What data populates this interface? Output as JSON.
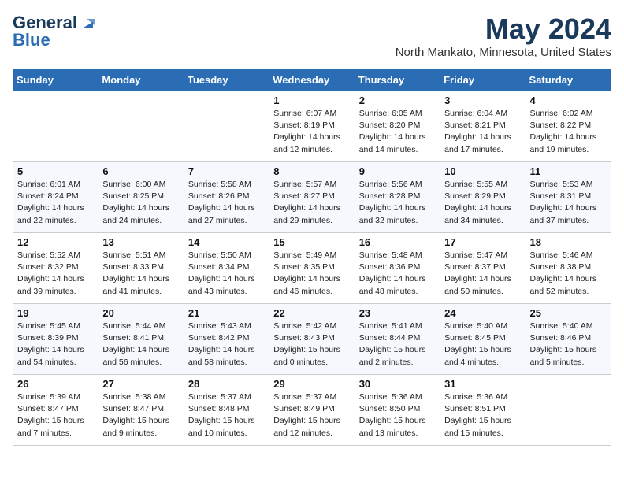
{
  "header": {
    "logo_general": "General",
    "logo_blue": "Blue",
    "month_title": "May 2024",
    "location": "North Mankato, Minnesota, United States"
  },
  "weekdays": [
    "Sunday",
    "Monday",
    "Tuesday",
    "Wednesday",
    "Thursday",
    "Friday",
    "Saturday"
  ],
  "weeks": [
    [
      {
        "day": "",
        "info": ""
      },
      {
        "day": "",
        "info": ""
      },
      {
        "day": "",
        "info": ""
      },
      {
        "day": "1",
        "info": "Sunrise: 6:07 AM\nSunset: 8:19 PM\nDaylight: 14 hours\nand 12 minutes."
      },
      {
        "day": "2",
        "info": "Sunrise: 6:05 AM\nSunset: 8:20 PM\nDaylight: 14 hours\nand 14 minutes."
      },
      {
        "day": "3",
        "info": "Sunrise: 6:04 AM\nSunset: 8:21 PM\nDaylight: 14 hours\nand 17 minutes."
      },
      {
        "day": "4",
        "info": "Sunrise: 6:02 AM\nSunset: 8:22 PM\nDaylight: 14 hours\nand 19 minutes."
      }
    ],
    [
      {
        "day": "5",
        "info": "Sunrise: 6:01 AM\nSunset: 8:24 PM\nDaylight: 14 hours\nand 22 minutes."
      },
      {
        "day": "6",
        "info": "Sunrise: 6:00 AM\nSunset: 8:25 PM\nDaylight: 14 hours\nand 24 minutes."
      },
      {
        "day": "7",
        "info": "Sunrise: 5:58 AM\nSunset: 8:26 PM\nDaylight: 14 hours\nand 27 minutes."
      },
      {
        "day": "8",
        "info": "Sunrise: 5:57 AM\nSunset: 8:27 PM\nDaylight: 14 hours\nand 29 minutes."
      },
      {
        "day": "9",
        "info": "Sunrise: 5:56 AM\nSunset: 8:28 PM\nDaylight: 14 hours\nand 32 minutes."
      },
      {
        "day": "10",
        "info": "Sunrise: 5:55 AM\nSunset: 8:29 PM\nDaylight: 14 hours\nand 34 minutes."
      },
      {
        "day": "11",
        "info": "Sunrise: 5:53 AM\nSunset: 8:31 PM\nDaylight: 14 hours\nand 37 minutes."
      }
    ],
    [
      {
        "day": "12",
        "info": "Sunrise: 5:52 AM\nSunset: 8:32 PM\nDaylight: 14 hours\nand 39 minutes."
      },
      {
        "day": "13",
        "info": "Sunrise: 5:51 AM\nSunset: 8:33 PM\nDaylight: 14 hours\nand 41 minutes."
      },
      {
        "day": "14",
        "info": "Sunrise: 5:50 AM\nSunset: 8:34 PM\nDaylight: 14 hours\nand 43 minutes."
      },
      {
        "day": "15",
        "info": "Sunrise: 5:49 AM\nSunset: 8:35 PM\nDaylight: 14 hours\nand 46 minutes."
      },
      {
        "day": "16",
        "info": "Sunrise: 5:48 AM\nSunset: 8:36 PM\nDaylight: 14 hours\nand 48 minutes."
      },
      {
        "day": "17",
        "info": "Sunrise: 5:47 AM\nSunset: 8:37 PM\nDaylight: 14 hours\nand 50 minutes."
      },
      {
        "day": "18",
        "info": "Sunrise: 5:46 AM\nSunset: 8:38 PM\nDaylight: 14 hours\nand 52 minutes."
      }
    ],
    [
      {
        "day": "19",
        "info": "Sunrise: 5:45 AM\nSunset: 8:39 PM\nDaylight: 14 hours\nand 54 minutes."
      },
      {
        "day": "20",
        "info": "Sunrise: 5:44 AM\nSunset: 8:41 PM\nDaylight: 14 hours\nand 56 minutes."
      },
      {
        "day": "21",
        "info": "Sunrise: 5:43 AM\nSunset: 8:42 PM\nDaylight: 14 hours\nand 58 minutes."
      },
      {
        "day": "22",
        "info": "Sunrise: 5:42 AM\nSunset: 8:43 PM\nDaylight: 15 hours\nand 0 minutes."
      },
      {
        "day": "23",
        "info": "Sunrise: 5:41 AM\nSunset: 8:44 PM\nDaylight: 15 hours\nand 2 minutes."
      },
      {
        "day": "24",
        "info": "Sunrise: 5:40 AM\nSunset: 8:45 PM\nDaylight: 15 hours\nand 4 minutes."
      },
      {
        "day": "25",
        "info": "Sunrise: 5:40 AM\nSunset: 8:46 PM\nDaylight: 15 hours\nand 5 minutes."
      }
    ],
    [
      {
        "day": "26",
        "info": "Sunrise: 5:39 AM\nSunset: 8:47 PM\nDaylight: 15 hours\nand 7 minutes."
      },
      {
        "day": "27",
        "info": "Sunrise: 5:38 AM\nSunset: 8:47 PM\nDaylight: 15 hours\nand 9 minutes."
      },
      {
        "day": "28",
        "info": "Sunrise: 5:37 AM\nSunset: 8:48 PM\nDaylight: 15 hours\nand 10 minutes."
      },
      {
        "day": "29",
        "info": "Sunrise: 5:37 AM\nSunset: 8:49 PM\nDaylight: 15 hours\nand 12 minutes."
      },
      {
        "day": "30",
        "info": "Sunrise: 5:36 AM\nSunset: 8:50 PM\nDaylight: 15 hours\nand 13 minutes."
      },
      {
        "day": "31",
        "info": "Sunrise: 5:36 AM\nSunset: 8:51 PM\nDaylight: 15 hours\nand 15 minutes."
      },
      {
        "day": "",
        "info": ""
      }
    ]
  ]
}
